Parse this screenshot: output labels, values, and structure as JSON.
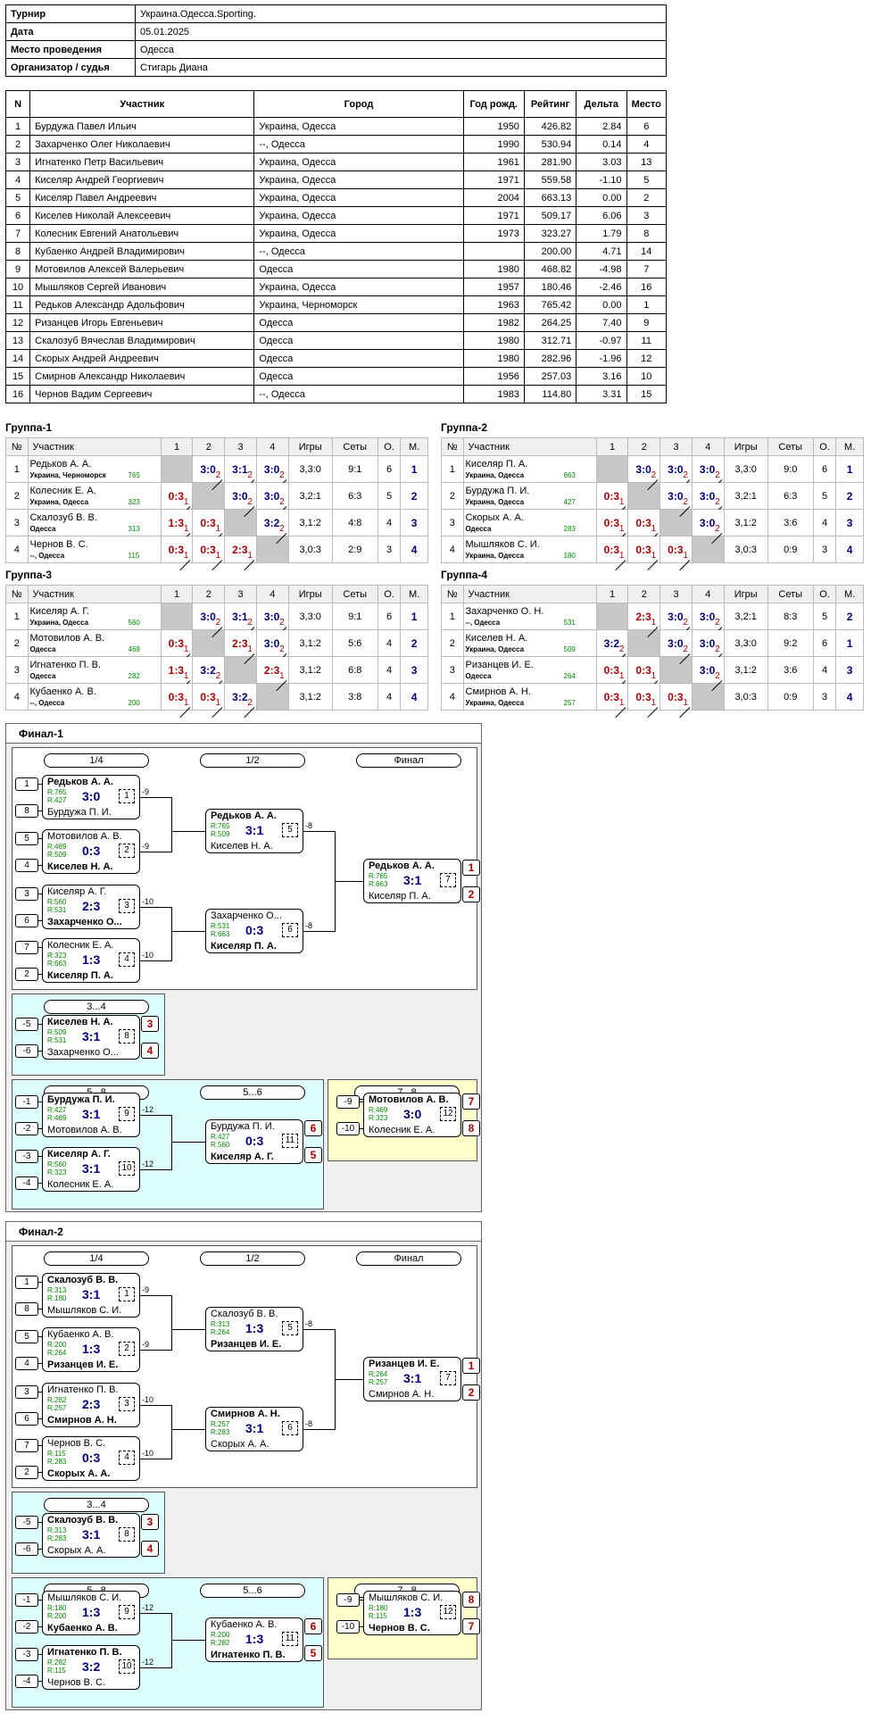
{
  "info": [
    [
      "Турнир",
      "Украина.Одесса.Sporting."
    ],
    [
      "Дата",
      "05.01.2025"
    ],
    [
      "Место проведения",
      "Одесса"
    ],
    [
      "Организатор / судья",
      "Стигарь Диана"
    ]
  ],
  "players_header": [
    "N",
    "Участник",
    "Город",
    "Год рожд.",
    "Рейтинг",
    "Дельта",
    "Место"
  ],
  "players": [
    [
      "1",
      "Бурдужа Павел Ильич",
      "Украина, Одесса",
      "1950",
      "426.82",
      "2.84",
      "6"
    ],
    [
      "2",
      "Захарченко Олег Николаевич",
      "--, Одесса",
      "1990",
      "530.94",
      "0.14",
      "4"
    ],
    [
      "3",
      "Игнатенко Петр Васильевич",
      "Украина, Одесса",
      "1961",
      "281.90",
      "3.03",
      "13"
    ],
    [
      "4",
      "Киселяр Андрей Георгиевич",
      "Украина, Одесса",
      "1971",
      "559.58",
      "-1.10",
      "5"
    ],
    [
      "5",
      "Киселяр Павел Андреевич",
      "Украина, Одесса",
      "2004",
      "663.13",
      "0.00",
      "2"
    ],
    [
      "6",
      "Киселев Николай Алексеевич",
      "Украина, Одесса",
      "1971",
      "509.17",
      "6.06",
      "3"
    ],
    [
      "7",
      "Колесник Евгений Анатольевич",
      "Украина, Одесса",
      "1973",
      "323.27",
      "1.79",
      "8"
    ],
    [
      "8",
      "Кубаенко Андрей Владимирович",
      "--, Одесса",
      "",
      "200.00",
      "4.71",
      "14"
    ],
    [
      "9",
      "Мотовилов Алексей Валерьевич",
      "Одесса",
      "1980",
      "468.82",
      "-4.98",
      "7"
    ],
    [
      "10",
      "Мышляков Сергей Иванович",
      "Украина, Одесса",
      "1957",
      "180.46",
      "-2.46",
      "16"
    ],
    [
      "11",
      "Редьков Александр Адольфович",
      "Украина, Черноморск",
      "1963",
      "765.42",
      "0.00",
      "1"
    ],
    [
      "12",
      "Ризанцев Игорь Евгеньевич",
      "Одесса",
      "1982",
      "264.25",
      "7.40",
      "9"
    ],
    [
      "13",
      "Скалозуб Вячеслав Владимирович",
      "Одесса",
      "1980",
      "312.71",
      "-0.97",
      "11"
    ],
    [
      "14",
      "Скорых Андрей Андреевич",
      "Одесса",
      "1980",
      "282.96",
      "-1.96",
      "12"
    ],
    [
      "15",
      "Смирнов Александр Николаевич",
      "Одесса",
      "1956",
      "257.03",
      "3.16",
      "10"
    ],
    [
      "16",
      "Чернов Вадим Сергеевич",
      "--, Одесса",
      "1983",
      "114.80",
      "3.31",
      "15"
    ]
  ],
  "group_header": [
    "№",
    "Участник",
    "1",
    "2",
    "3",
    "4",
    "Игры",
    "Сеты",
    "О.",
    "М."
  ],
  "groups": [
    {
      "title": "Группа-1",
      "rows": [
        {
          "n": "1",
          "name": "Редьков А. А.",
          "city": "Украина, Черноморск",
          "rating": "765",
          "cells": [
            "X",
            [
              "3:0",
              "2",
              "w"
            ],
            [
              "3:1",
              "2",
              "w"
            ],
            [
              "3:0",
              "2",
              "w"
            ]
          ],
          "games": "3,3:0",
          "sets": "9:1",
          "pts": "6",
          "place": "1"
        },
        {
          "n": "2",
          "name": "Колесник Е. А.",
          "city": "Украина, Одесса",
          "rating": "323",
          "cells": [
            [
              "0:3",
              "1",
              "l"
            ],
            "X",
            [
              "3:0",
              "2",
              "w"
            ],
            [
              "3:0",
              "2",
              "w"
            ]
          ],
          "games": "3,2:1",
          "sets": "6:3",
          "pts": "5",
          "place": "2"
        },
        {
          "n": "3",
          "name": "Скалозуб В. В.",
          "city": "Одесса",
          "rating": "313",
          "cells": [
            [
              "1:3",
              "1",
              "l"
            ],
            [
              "0:3",
              "1",
              "l"
            ],
            "X",
            [
              "3:2",
              "2",
              "w"
            ]
          ],
          "games": "3,1:2",
          "sets": "4:8",
          "pts": "4",
          "place": "3"
        },
        {
          "n": "4",
          "name": "Чернов В. С.",
          "city": "--, Одесса",
          "rating": "115",
          "cells": [
            [
              "0:3",
              "1",
              "l"
            ],
            [
              "0:3",
              "1",
              "l"
            ],
            [
              "2:3",
              "1",
              "l"
            ],
            "X"
          ],
          "games": "3,0:3",
          "sets": "2:9",
          "pts": "3",
          "place": "4"
        }
      ]
    },
    {
      "title": "Группа-2",
      "rows": [
        {
          "n": "1",
          "name": "Киселяр П. А.",
          "city": "Украина, Одесса",
          "rating": "663",
          "cells": [
            "X",
            [
              "3:0",
              "2",
              "w"
            ],
            [
              "3:0",
              "2",
              "w"
            ],
            [
              "3:0",
              "2",
              "w"
            ]
          ],
          "games": "3,3:0",
          "sets": "9:0",
          "pts": "6",
          "place": "1"
        },
        {
          "n": "2",
          "name": "Бурдужа П. И.",
          "city": "Украина, Одесса",
          "rating": "427",
          "cells": [
            [
              "0:3",
              "1",
              "l"
            ],
            "X",
            [
              "3:0",
              "2",
              "w"
            ],
            [
              "3:0",
              "2",
              "w"
            ]
          ],
          "games": "3,2:1",
          "sets": "6:3",
          "pts": "5",
          "place": "2"
        },
        {
          "n": "3",
          "name": "Скорых А. А.",
          "city": "Одесса",
          "rating": "283",
          "cells": [
            [
              "0:3",
              "1",
              "l"
            ],
            [
              "0:3",
              "1",
              "l"
            ],
            "X",
            [
              "3:0",
              "2",
              "w"
            ]
          ],
          "games": "3,1:2",
          "sets": "3:6",
          "pts": "4",
          "place": "3"
        },
        {
          "n": "4",
          "name": "Мышляков С. И.",
          "city": "Украина, Одесса",
          "rating": "180",
          "cells": [
            [
              "0:3",
              "1",
              "l"
            ],
            [
              "0:3",
              "1",
              "l"
            ],
            [
              "0:3",
              "1",
              "l"
            ],
            "X"
          ],
          "games": "3,0:3",
          "sets": "0:9",
          "pts": "3",
          "place": "4"
        }
      ]
    },
    {
      "title": "Группа-3",
      "rows": [
        {
          "n": "1",
          "name": "Киселяр А. Г.",
          "city": "Украина, Одесса",
          "rating": "560",
          "cells": [
            "X",
            [
              "3:0",
              "2",
              "w"
            ],
            [
              "3:1",
              "2",
              "w"
            ],
            [
              "3:0",
              "2",
              "w"
            ]
          ],
          "games": "3,3:0",
          "sets": "9:1",
          "pts": "6",
          "place": "1"
        },
        {
          "n": "2",
          "name": "Мотовилов А. В.",
          "city": "Одесса",
          "rating": "469",
          "cells": [
            [
              "0:3",
              "1",
              "l"
            ],
            "X",
            [
              "2:3",
              "1",
              "l"
            ],
            [
              "3:0",
              "2",
              "w"
            ]
          ],
          "games": "3,1:2",
          "sets": "5:6",
          "pts": "4",
          "place": "2"
        },
        {
          "n": "3",
          "name": "Игнатенко П. В.",
          "city": "Одесса",
          "rating": "282",
          "cells": [
            [
              "1:3",
              "1",
              "l"
            ],
            [
              "3:2",
              "2",
              "w"
            ],
            "X",
            [
              "2:3",
              "1",
              "l"
            ]
          ],
          "games": "3,1:2",
          "sets": "6:8",
          "pts": "4",
          "place": "3"
        },
        {
          "n": "4",
          "name": "Кубаенко А. В.",
          "city": "--, Одесса",
          "rating": "200",
          "cells": [
            [
              "0:3",
              "1",
              "l"
            ],
            [
              "0:3",
              "1",
              "l"
            ],
            [
              "3:2",
              "2",
              "w"
            ],
            "X"
          ],
          "games": "3,1:2",
          "sets": "3:8",
          "pts": "4",
          "place": "4"
        }
      ]
    },
    {
      "title": "Группа-4",
      "rows": [
        {
          "n": "1",
          "name": "Захарченко О. Н.",
          "city": "--, Одесса",
          "rating": "531",
          "cells": [
            "X",
            [
              "2:3",
              "1",
              "l"
            ],
            [
              "3:0",
              "2",
              "w"
            ],
            [
              "3:0",
              "2",
              "w"
            ]
          ],
          "games": "3,2:1",
          "sets": "8:3",
          "pts": "5",
          "place": "2"
        },
        {
          "n": "2",
          "name": "Киселев Н. А.",
          "city": "Украина, Одесса",
          "rating": "509",
          "cells": [
            [
              "3:2",
              "2",
              "w"
            ],
            "X",
            [
              "3:0",
              "2",
              "w"
            ],
            [
              "3:0",
              "2",
              "w"
            ]
          ],
          "games": "3,3:0",
          "sets": "9:2",
          "pts": "6",
          "place": "1"
        },
        {
          "n": "3",
          "name": "Ризанцев И. Е.",
          "city": "Одесса",
          "rating": "264",
          "cells": [
            [
              "0:3",
              "1",
              "l"
            ],
            [
              "0:3",
              "1",
              "l"
            ],
            "X",
            [
              "3:0",
              "2",
              "w"
            ]
          ],
          "games": "3,1:2",
          "sets": "3:6",
          "pts": "4",
          "place": "3"
        },
        {
          "n": "4",
          "name": "Смирнов А. Н.",
          "city": "Украина, Одесса",
          "rating": "257",
          "cells": [
            [
              "0:3",
              "1",
              "l"
            ],
            [
              "0:3",
              "1",
              "l"
            ],
            [
              "0:3",
              "1",
              "l"
            ],
            "X"
          ],
          "games": "3,0:3",
          "sets": "0:9",
          "pts": "3",
          "place": "4"
        }
      ]
    }
  ],
  "finals": [
    {
      "title": "Финал-1",
      "labels": {
        "r1": "1/4",
        "r2": "1/2",
        "r3": "Финал",
        "third": "3...4",
        "p58": "5...8",
        "p56": "5...6",
        "p78": "7...8"
      },
      "matches": [
        {
          "a": "Редьков А. А.",
          "b": "Бурдужа П. И.",
          "ra": "R:765",
          "rb": "R:427",
          "s": "3:0",
          "n": "1",
          "w": "a",
          "sa": "1",
          "sb": "8",
          "out": "-9"
        },
        {
          "a": "Мотовилов А. В.",
          "b": "Киселев Н. А.",
          "ra": "R:469",
          "rb": "R:509",
          "s": "0:3",
          "n": "2",
          "w": "b",
          "sa": "5",
          "sb": "4",
          "out": "-9"
        },
        {
          "a": "Киселяр А. Г.",
          "b": "Захарченко О...",
          "ra": "R:560",
          "rb": "R:531",
          "s": "2:3",
          "n": "3",
          "w": "b",
          "sa": "3",
          "sb": "6",
          "out": "-10"
        },
        {
          "a": "Колесник Е. А.",
          "b": "Киселяр П. А.",
          "ra": "R:323",
          "rb": "R:663",
          "s": "1:3",
          "n": "4",
          "w": "b",
          "sa": "7",
          "sb": "2",
          "out": "-10"
        },
        {
          "a": "Редьков А. А.",
          "b": "Киселев Н. А.",
          "ra": "R:765",
          "rb": "R:509",
          "s": "3:1",
          "n": "5",
          "w": "a",
          "out": "-8"
        },
        {
          "a": "Захарченко О...",
          "b": "Киселяр П. А.",
          "ra": "R:531",
          "rb": "R:663",
          "s": "0:3",
          "n": "6",
          "w": "b",
          "out": "-8"
        },
        {
          "a": "Редьков А. А.",
          "b": "Киселяр П. А.",
          "ra": "R:765",
          "rb": "R:663",
          "s": "3:1",
          "n": "7",
          "w": "a",
          "pa": "1",
          "pb": "2"
        },
        {
          "a": "Киселев Н. А.",
          "b": "Захарченко О...",
          "ra": "R:509",
          "rb": "R:531",
          "s": "3:1",
          "n": "8",
          "w": "a",
          "sa": "-5",
          "sb": "-6",
          "pa": "3",
          "pb": "4"
        },
        {
          "a": "Бурдужа П. И.",
          "b": "Мотовилов А. В.",
          "ra": "R:427",
          "rb": "R:469",
          "s": "3:1",
          "n": "9",
          "w": "a",
          "sa": "-1",
          "sb": "-2",
          "out": "-12"
        },
        {
          "a": "Киселяр А. Г.",
          "b": "Колесник Е. А.",
          "ra": "R:560",
          "rb": "R:323",
          "s": "3:1",
          "n": "10",
          "w": "a",
          "sa": "-3",
          "sb": "-4",
          "out": "-12"
        },
        {
          "a": "Бурдужа П. И.",
          "b": "Киселяр А. Г.",
          "ra": "R:427",
          "rb": "R:560",
          "s": "0:3",
          "n": "11",
          "w": "b",
          "pa": "6",
          "pb": "5"
        },
        {
          "a": "Мотовилов А. В.",
          "b": "Колесник Е. А.",
          "ra": "R:469",
          "rb": "R:323",
          "s": "3:0",
          "n": "12",
          "w": "a",
          "sa": "-9",
          "sb": "-10",
          "pa": "7",
          "pb": "8"
        }
      ]
    },
    {
      "title": "Финал-2",
      "labels": {
        "r1": "1/4",
        "r2": "1/2",
        "r3": "Финал",
        "third": "3...4",
        "p58": "5...8",
        "p56": "5...6",
        "p78": "7...8"
      },
      "matches": [
        {
          "a": "Скалозуб В. В.",
          "b": "Мышляков С. И.",
          "ra": "R:313",
          "rb": "R:180",
          "s": "3:1",
          "n": "1",
          "w": "a",
          "sa": "1",
          "sb": "8",
          "out": "-9"
        },
        {
          "a": "Кубаенко А. В.",
          "b": "Ризанцев И. Е.",
          "ra": "R:200",
          "rb": "R:264",
          "s": "1:3",
          "n": "2",
          "w": "b",
          "sa": "5",
          "sb": "4",
          "out": "-9"
        },
        {
          "a": "Игнатенко П. В.",
          "b": "Смирнов А. Н.",
          "ra": "R:282",
          "rb": "R:257",
          "s": "2:3",
          "n": "3",
          "w": "b",
          "sa": "3",
          "sb": "6",
          "out": "-10"
        },
        {
          "a": "Чернов В. С.",
          "b": "Скорых А. А.",
          "ra": "R:115",
          "rb": "R:283",
          "s": "0:3",
          "n": "4",
          "w": "b",
          "sa": "7",
          "sb": "2",
          "out": "-10"
        },
        {
          "a": "Скалозуб В. В.",
          "b": "Ризанцев И. Е.",
          "ra": "R:313",
          "rb": "R:264",
          "s": "1:3",
          "n": "5",
          "w": "b",
          "out": "-8"
        },
        {
          "a": "Смирнов А. Н.",
          "b": "Скорых А. А.",
          "ra": "R:257",
          "rb": "R:283",
          "s": "3:1",
          "n": "6",
          "w": "a",
          "out": "-8"
        },
        {
          "a": "Ризанцев И. Е.",
          "b": "Смирнов А. Н.",
          "ra": "R:264",
          "rb": "R:257",
          "s": "3:1",
          "n": "7",
          "w": "a",
          "pa": "1",
          "pb": "2"
        },
        {
          "a": "Скалозуб В. В.",
          "b": "Скорых А. А.",
          "ra": "R:313",
          "rb": "R:283",
          "s": "3:1",
          "n": "8",
          "w": "a",
          "sa": "-5",
          "sb": "-6",
          "pa": "3",
          "pb": "4"
        },
        {
          "a": "Мышляков С. И.",
          "b": "Кубаенко А. В.",
          "ra": "R:180",
          "rb": "R:200",
          "s": "1:3",
          "n": "9",
          "w": "b",
          "sa": "-1",
          "sb": "-2",
          "out": "-12"
        },
        {
          "a": "Игнатенко П. В.",
          "b": "Чернов В. С.",
          "ra": "R:282",
          "rb": "R:115",
          "s": "3:2",
          "n": "10",
          "w": "a",
          "sa": "-3",
          "sb": "-4",
          "out": "-12"
        },
        {
          "a": "Кубаенко А. В.",
          "b": "Игнатенко П. В.",
          "ra": "R:200",
          "rb": "R:282",
          "s": "1:3",
          "n": "11",
          "w": "b",
          "pa": "6",
          "pb": "5"
        },
        {
          "a": "Мышляков С. И.",
          "b": "Чернов В. С.",
          "ra": "R:180",
          "rb": "R:115",
          "s": "1:3",
          "n": "12",
          "w": "b",
          "sa": "-9",
          "sb": "-10",
          "pa": "8",
          "pb": "7"
        }
      ]
    }
  ]
}
